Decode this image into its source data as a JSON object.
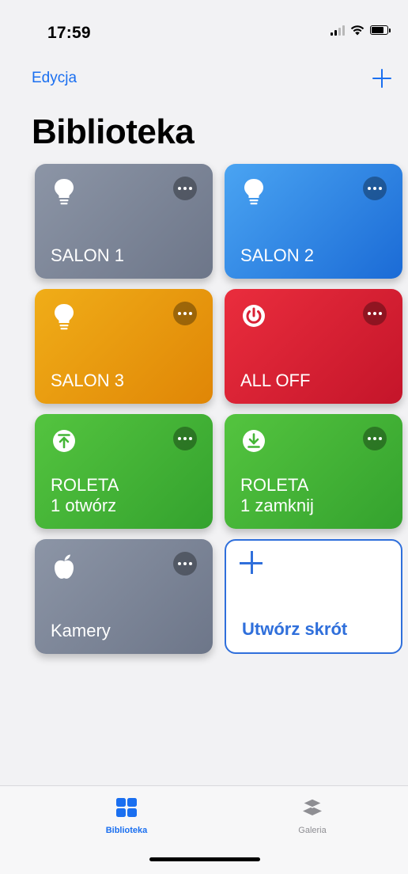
{
  "status_bar": {
    "time": "17:59"
  },
  "nav": {
    "edit_label": "Edycja",
    "add_icon": "plus-icon"
  },
  "page_title": "Biblioteka",
  "shortcuts": [
    {
      "label": "SALON 1",
      "icon": "lightbulb-icon",
      "color": "#7d8699"
    },
    {
      "label": "SALON 2",
      "icon": "lightbulb-icon",
      "color": "#2f86e6"
    },
    {
      "label": "SALON 3",
      "icon": "lightbulb-icon",
      "color": "#e99a10"
    },
    {
      "label": "ALL OFF",
      "icon": "power-icon",
      "color": "#d92034"
    },
    {
      "label_line1": "ROLETA",
      "label_line2": "1 otwórz",
      "icon": "upload-arrow-icon",
      "color": "#44b536"
    },
    {
      "label_line1": "ROLETA",
      "label_line2": "1 zamknij",
      "icon": "download-arrow-icon",
      "color": "#44b536"
    },
    {
      "label": "Kamery",
      "icon": "apple-icon",
      "color": "#7d8699"
    }
  ],
  "create_shortcut": {
    "label": "Utwórz skrót",
    "icon": "plus-icon",
    "accent": "#2f6fdb"
  },
  "tab_bar": {
    "tabs": [
      {
        "label": "Biblioteka",
        "icon": "grid-icon",
        "selected": true
      },
      {
        "label": "Galeria",
        "icon": "layers-icon",
        "selected": false
      }
    ]
  },
  "colors": {
    "accent": "#1a6ff0"
  }
}
